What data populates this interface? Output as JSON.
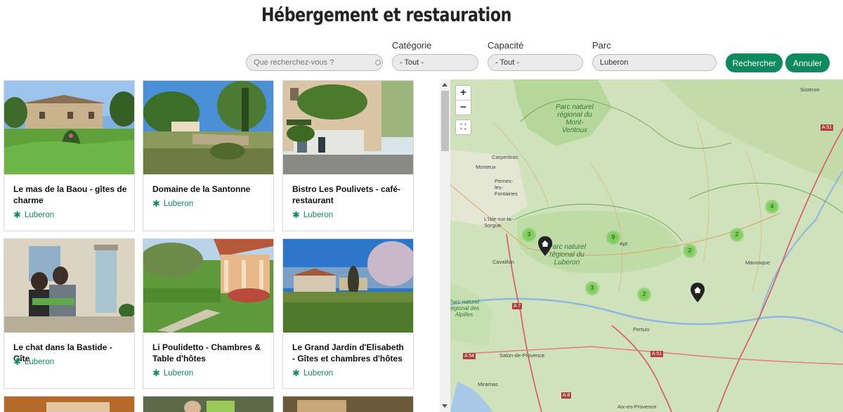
{
  "page": {
    "title": "Hébergement et restauration"
  },
  "filters": {
    "search_placeholder": "Que recherchez-vous ?",
    "category": {
      "label": "Catégorie",
      "value": "- Tout -"
    },
    "capacity": {
      "label": "Capacité",
      "value": "- Tout -"
    },
    "park": {
      "label": "Parc",
      "value": "Luberon"
    },
    "search_button": "Rechercher",
    "cancel_button": "Annuler"
  },
  "cards": [
    {
      "name": "Le mas de la Baou - gîtes de charme",
      "park": "Luberon"
    },
    {
      "name": "Domaine de la Santonne",
      "park": "Luberon"
    },
    {
      "name": "Bistro Les Poulivets - café-restaurant",
      "park": "Luberon"
    },
    {
      "name": "Le chat dans la Bastide - Gîte",
      "park": "Luberon"
    },
    {
      "name": "Li Poulidetto - Chambres & Table d'hôtes",
      "park": "Luberon"
    },
    {
      "name": "Le Grand Jardin d'Elisabeth - Gîtes et chambres d'hôtes",
      "park": "Luberon"
    }
  ],
  "map": {
    "zoom_in": "+",
    "zoom_out": "−",
    "fullscreen": "⛶",
    "clusters": [
      "3",
      "9",
      "4",
      "2",
      "2",
      "3",
      "2"
    ],
    "places": {
      "sisteron": "Sisteron",
      "carpentras": "Carpentras",
      "monteux": "Monteux",
      "pernes": "Pernes-les-Fontaines",
      "isle": "L'Isle-sur-la-Sorgue",
      "apt": "Apt",
      "cavaillon": "Cavaillon",
      "manosque": "Manosque",
      "pertuis": "Pertuis",
      "salon": "Salon-de-Provence",
      "miramas": "Miramas",
      "aix": "Aix-en-Provence"
    },
    "parks": {
      "ventoux": "Parc naturel régional du Mont-Ventoux",
      "luberon": "Parc naturel régional du Luberon",
      "alpilles": "Parc naturel régional des Alpilles"
    },
    "roads": {
      "a51_top": "A 51",
      "a7": "A 7",
      "a54": "A 54",
      "a51_bottom": "A 51",
      "a8": "A 8"
    }
  }
}
